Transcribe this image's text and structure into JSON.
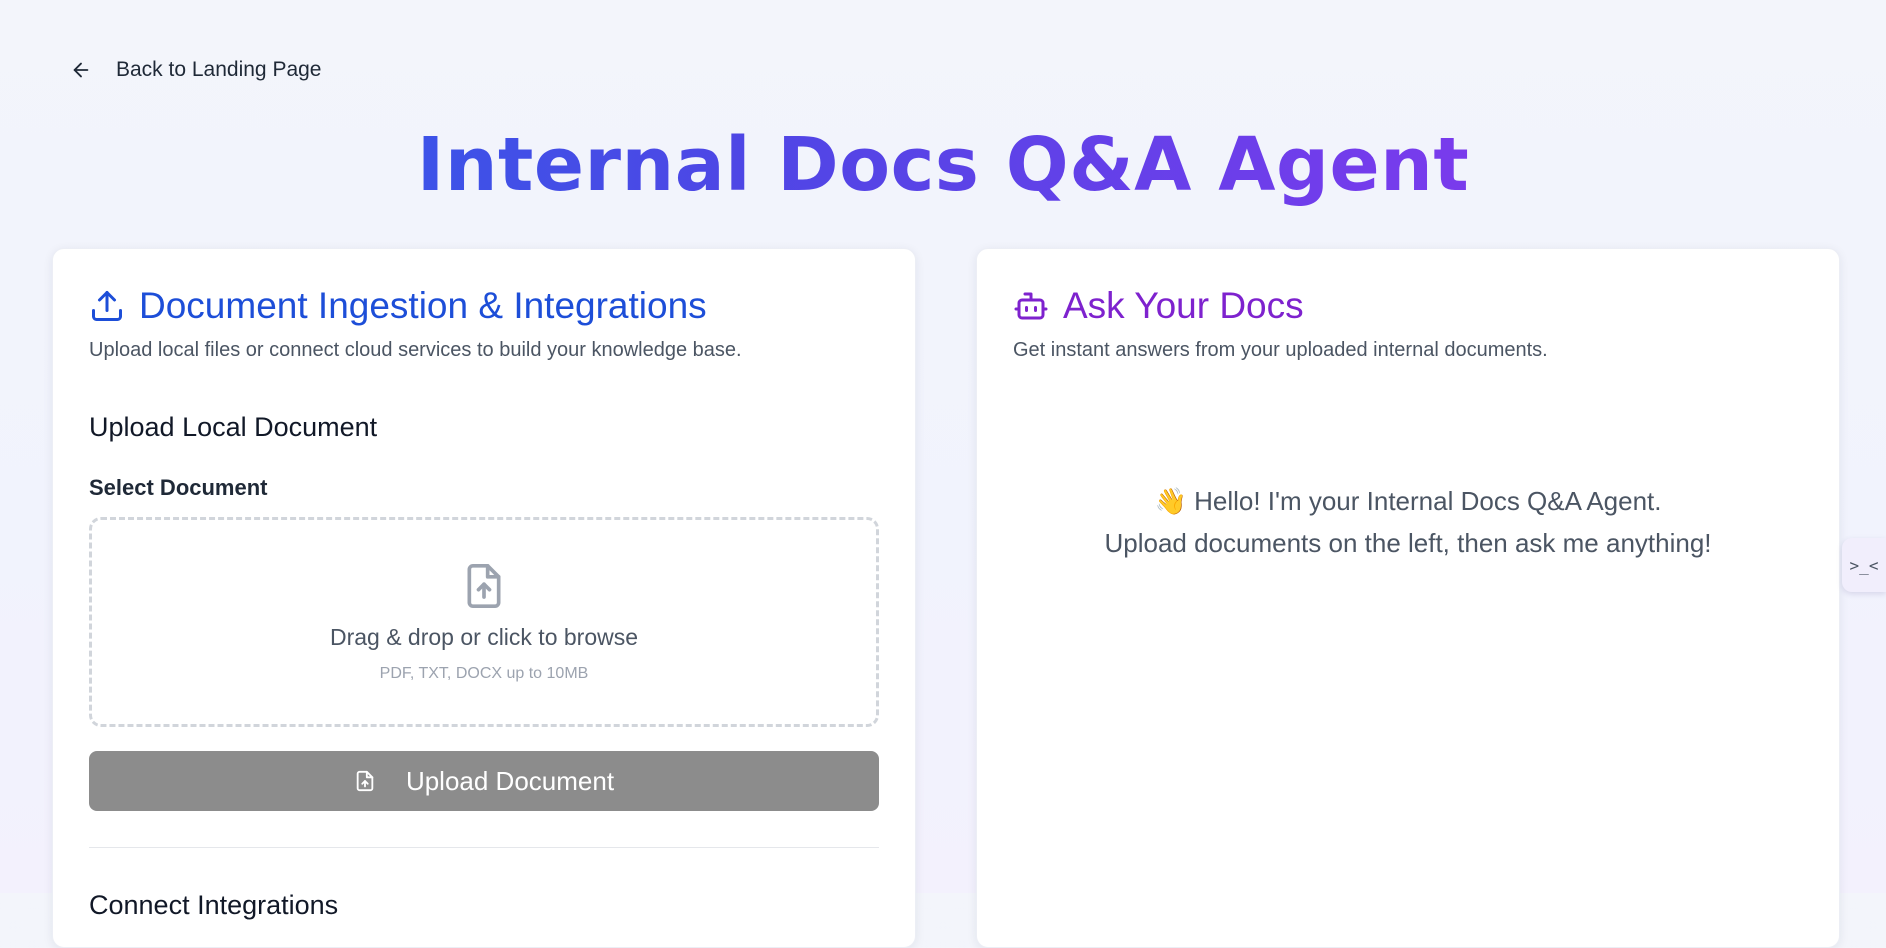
{
  "nav": {
    "back_label": "Back to Landing Page"
  },
  "page": {
    "title": "Internal Docs Q&A Agent"
  },
  "ingestion": {
    "title": "Document Ingestion & Integrations",
    "subtitle": "Upload local files or connect cloud services to build your knowledge base.",
    "section_title": "Upload Local Document",
    "field_label": "Select Document",
    "dropzone_text": "Drag & drop or click to browse",
    "dropzone_hint": "PDF, TXT, DOCX up to 10MB",
    "upload_button": "Upload Document",
    "next_section": "Connect Integrations"
  },
  "chat": {
    "title": "Ask Your Docs",
    "subtitle": "Get instant answers from your uploaded internal documents.",
    "greeting_emoji": "👋",
    "greeting_line1": " Hello! I'm your Internal Docs Q&A Agent.",
    "greeting_line2": "Upload documents on the left, then ask me anything!"
  },
  "side_tab": {
    "glyph": ">_<"
  },
  "colors": {
    "title_gradient_start": "#2563eb",
    "title_gradient_end": "#7e22ce",
    "ingestion_accent": "#1d4ed8",
    "chat_accent": "#7e22ce",
    "upload_button_disabled": "#8c8c8c"
  },
  "icons": {
    "back": "arrow-left-icon",
    "ingestion": "upload-icon",
    "chat": "bot-icon",
    "dropzone": "file-upload-icon",
    "upload_button": "file-upload-icon"
  }
}
